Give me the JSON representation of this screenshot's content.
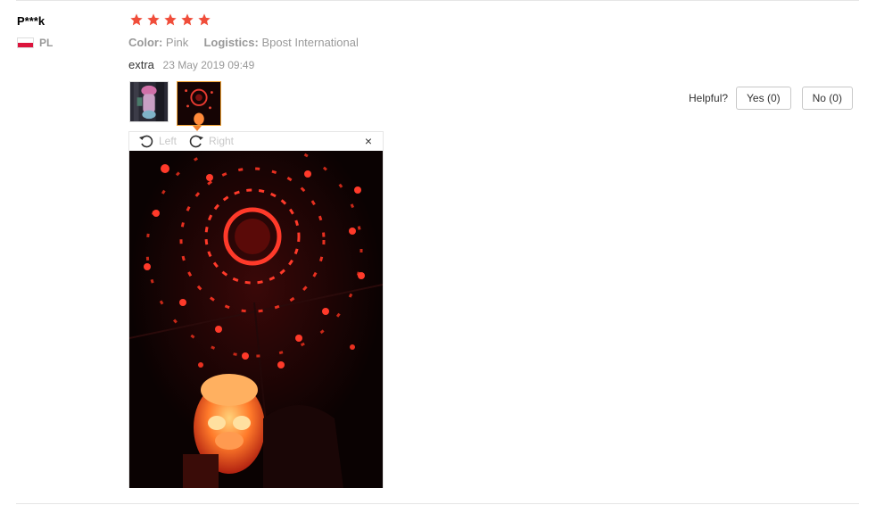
{
  "review": {
    "user_name": "P***k",
    "country_code": "PL",
    "rating": 5,
    "color_label": "Color:",
    "color_value": "Pink",
    "logistics_label": "Logistics:",
    "logistics_value": "Bpost International",
    "text": "extra",
    "date": "23 May 2019 09:49"
  },
  "viewer": {
    "rotate_left": "Left",
    "rotate_right": "Right",
    "close": "×"
  },
  "helpful": {
    "label": "Helpful?",
    "yes": "Yes (0)",
    "no": "No (0)"
  },
  "colors": {
    "star": "#f04d3a",
    "thumb_active_border": "#f0a030"
  }
}
